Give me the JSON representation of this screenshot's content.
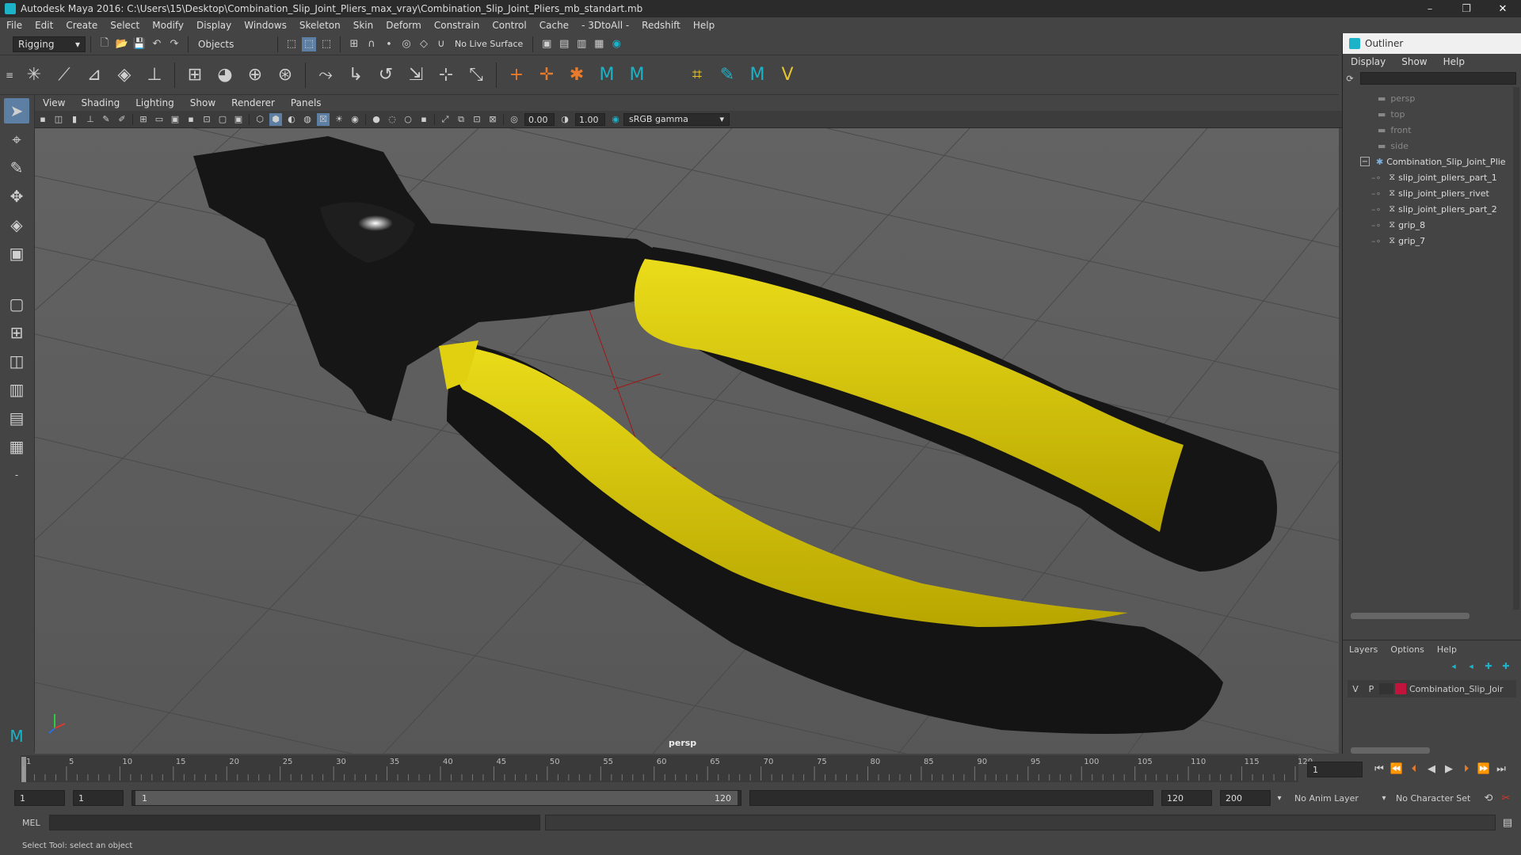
{
  "window": {
    "title": "Autodesk Maya 2016: C:\\Users\\15\\Desktop\\Combination_Slip_Joint_Pliers_max_vray\\Combination_Slip_Joint_Pliers_mb_standart.mb",
    "minimize": "–",
    "restore": "❐",
    "close": "✕"
  },
  "menu": [
    "File",
    "Edit",
    "Create",
    "Select",
    "Modify",
    "Display",
    "Windows",
    "Skeleton",
    "Skin",
    "Deform",
    "Constrain",
    "Control",
    "Cache",
    "- 3DtoAll -",
    "Redshift",
    "Help"
  ],
  "status": {
    "mode": "Rigging",
    "objects": "Objects",
    "live_surface": "No Live Surface"
  },
  "panel": {
    "menu": [
      "View",
      "Shading",
      "Lighting",
      "Show",
      "Renderer",
      "Panels"
    ],
    "exposure": "0.00",
    "gamma": "1.00",
    "color_space": "sRGB gamma",
    "camera_label": "persp"
  },
  "outliner": {
    "title": "Outliner",
    "menu": [
      "Display",
      "Show",
      "Help"
    ],
    "items": [
      {
        "label": "persp",
        "dim": true
      },
      {
        "label": "top",
        "dim": true
      },
      {
        "label": "front",
        "dim": true
      },
      {
        "label": "side",
        "dim": true
      },
      {
        "label": "Combination_Slip_Joint_Plie",
        "dim": false
      },
      {
        "label": "slip_joint_pliers_part_1",
        "dim": false
      },
      {
        "label": "slip_joint_pliers_rivet",
        "dim": false
      },
      {
        "label": "slip_joint_pliers_part_2",
        "dim": false
      },
      {
        "label": "grip_8",
        "dim": false
      },
      {
        "label": "grip_7",
        "dim": false
      }
    ],
    "collapse_symbol": "−"
  },
  "layers": {
    "menu": [
      "Layers",
      "Options",
      "Help"
    ],
    "row": {
      "v": "V",
      "p": "P",
      "name": "Combination_Slip_Joir"
    },
    "color": "#c0143c"
  },
  "timeline": {
    "ticks": [
      "1",
      "5",
      "10",
      "15",
      "20",
      "25",
      "30",
      "35",
      "40",
      "45",
      "50",
      "55",
      "60",
      "65",
      "70",
      "75",
      "80",
      "85",
      "90",
      "95",
      "100",
      "105",
      "110",
      "115",
      "120"
    ],
    "current": "1"
  },
  "range": {
    "start": "1",
    "start2": "1",
    "slider_start": "1",
    "slider_end": "120",
    "end": "120",
    "end2": "200",
    "anim_layer": "No Anim Layer",
    "char_set": "No Character Set"
  },
  "mel": {
    "label": "MEL"
  },
  "help": {
    "text": "Select Tool: select an object"
  },
  "colors": {
    "accent": "#1cb3c8",
    "grip_yellow": "#d6c400",
    "body_black": "#1a1a1a"
  }
}
